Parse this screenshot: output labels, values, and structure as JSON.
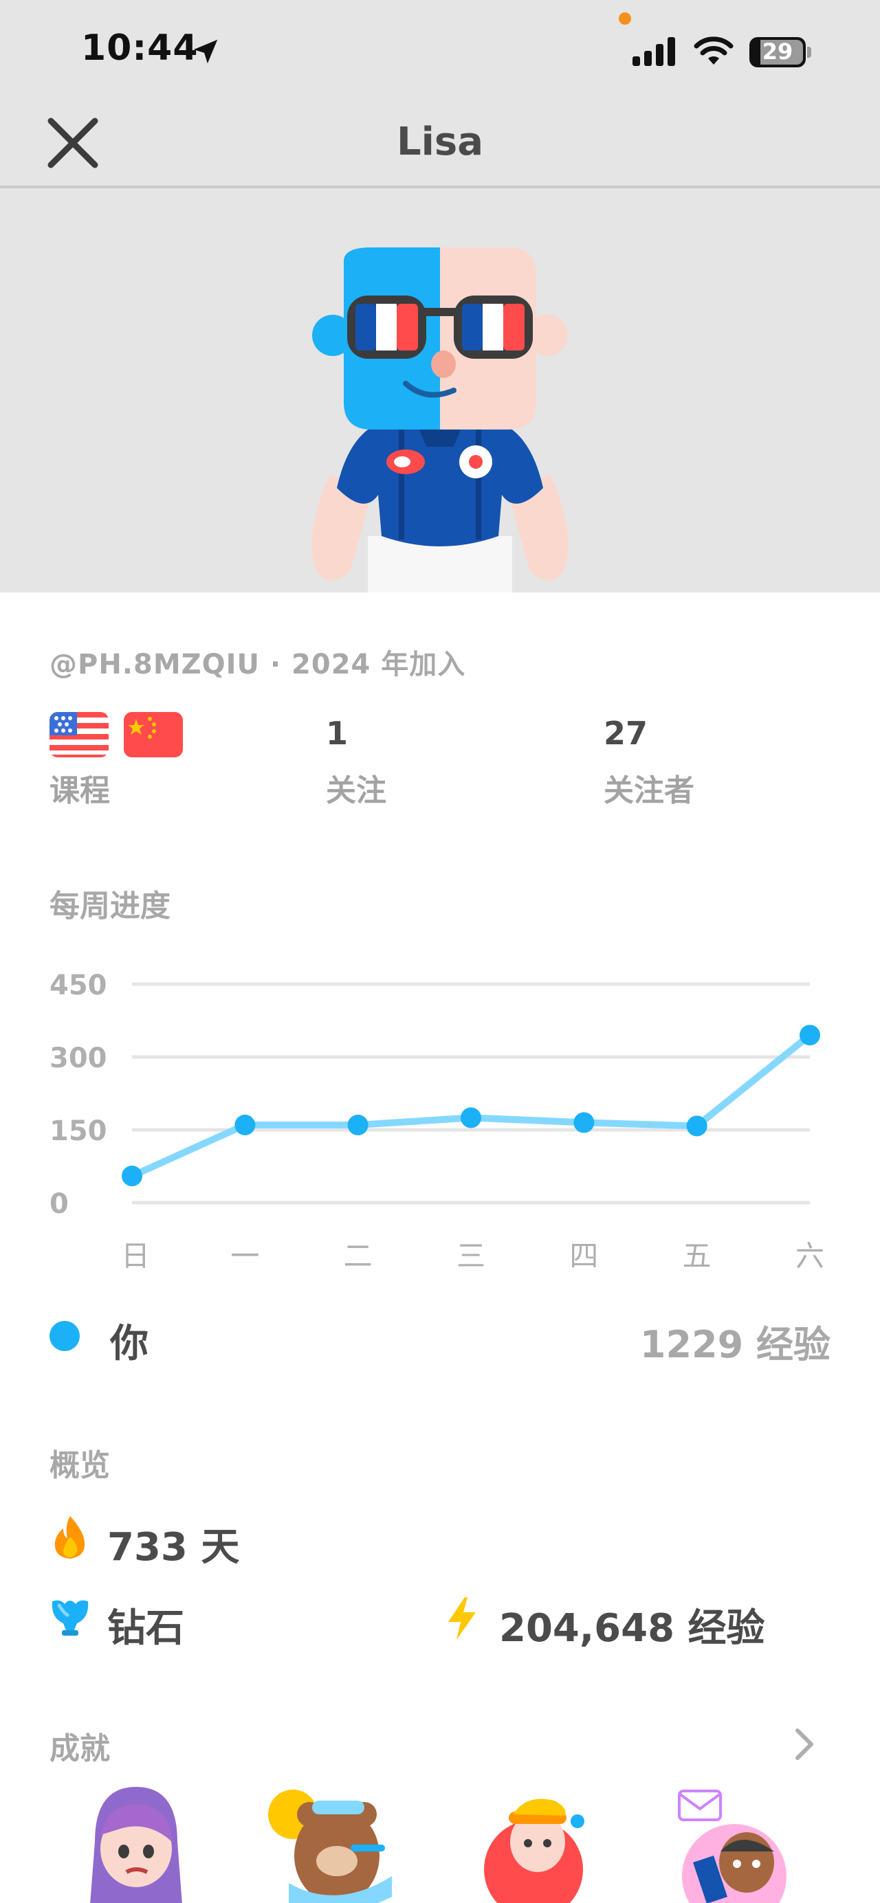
{
  "status_bar": {
    "time": "10:44",
    "battery": "29"
  },
  "nav": {
    "title": "Lisa"
  },
  "profile": {
    "handle": "@PH.8MZQIU · 2024 年加入"
  },
  "stats": {
    "courses_label": "课程",
    "following_value": "1",
    "following_label": "关注",
    "followers_value": "27",
    "followers_label": "关注者"
  },
  "weekly": {
    "title": "每周进度",
    "legend_you": "你",
    "legend_xp": "1229 经验"
  },
  "chart_data": {
    "type": "line",
    "categories": [
      "日",
      "一",
      "二",
      "三",
      "四",
      "五",
      "六"
    ],
    "series": [
      {
        "name": "你",
        "values": [
          55,
          160,
          160,
          175,
          165,
          158,
          345
        ]
      }
    ],
    "yticks": [
      "0",
      "150",
      "300",
      "450"
    ],
    "ylim": [
      0,
      450
    ],
    "grid": true,
    "color": "#1cb0f6"
  },
  "overview": {
    "title": "概览",
    "streak": "733 天",
    "league": "钻石",
    "total_xp": "204,648 经验"
  },
  "achievements": {
    "title": "成就"
  },
  "colors": {
    "accent": "#1cb0f6",
    "streak": "#ff9600",
    "xp": "#ffc800",
    "league": "#1cb0f6"
  }
}
